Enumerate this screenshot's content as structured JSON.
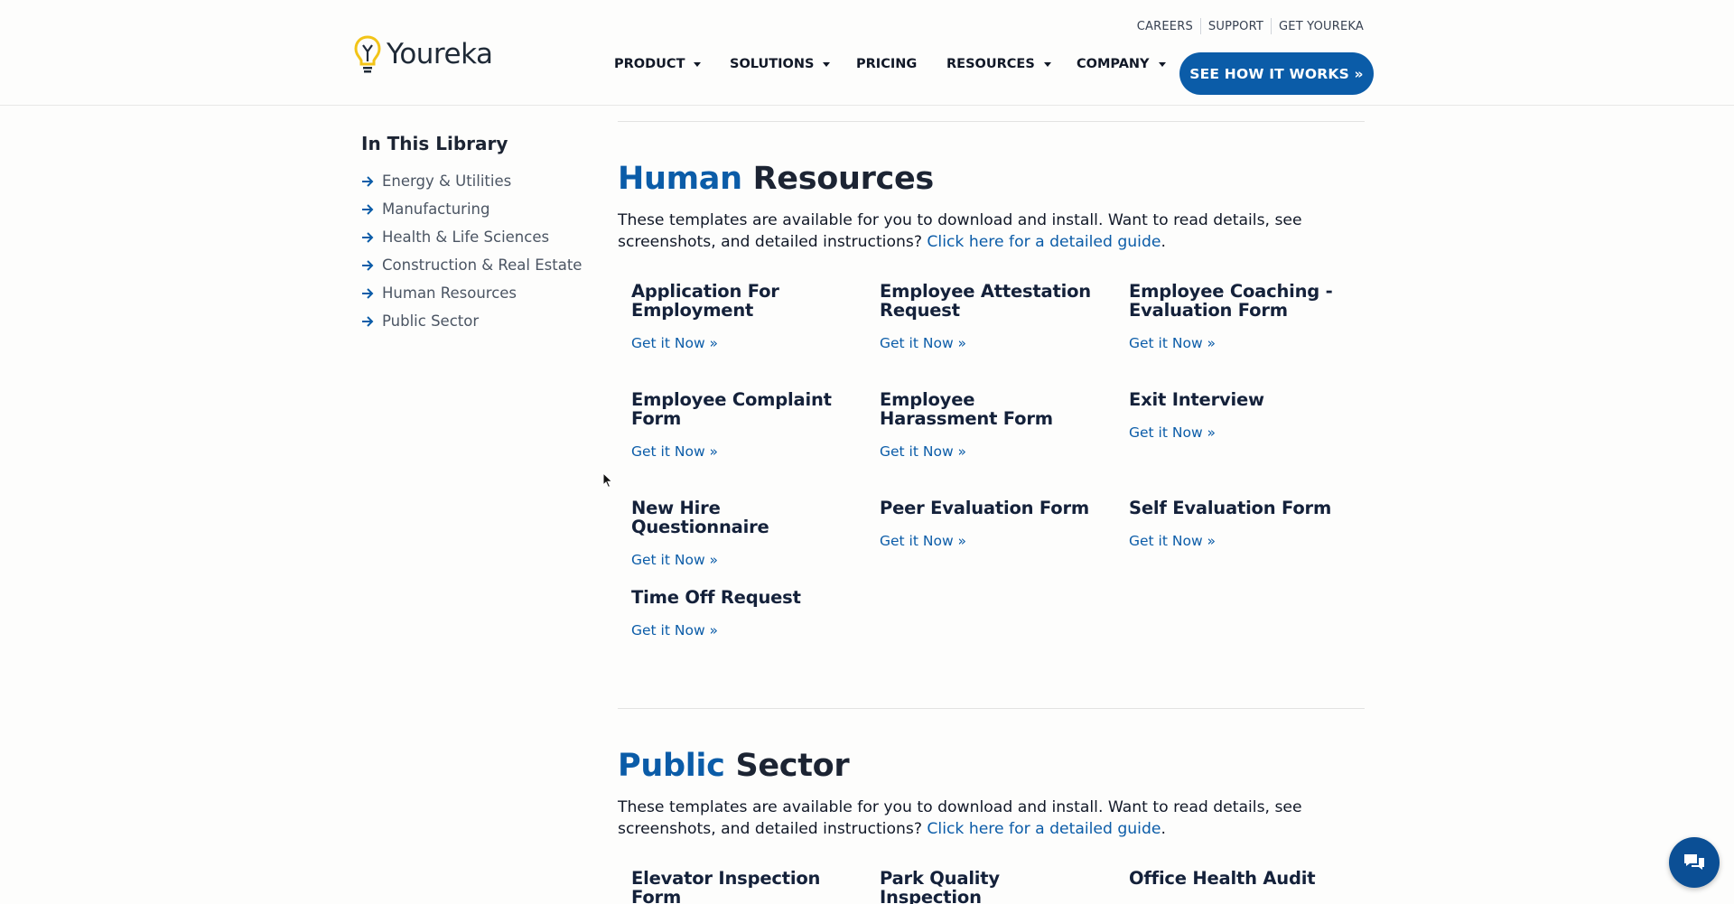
{
  "brand": {
    "name": "Youreka"
  },
  "top_links": [
    "CAREERS",
    "SUPPORT",
    "GET YOUREKA"
  ],
  "nav": [
    {
      "label": "PRODUCT",
      "dropdown": true
    },
    {
      "label": "SOLUTIONS",
      "dropdown": true
    },
    {
      "label": "PRICING",
      "dropdown": false
    },
    {
      "label": "RESOURCES",
      "dropdown": true
    },
    {
      "label": "COMPANY",
      "dropdown": true
    }
  ],
  "cta": {
    "label": "SEE HOW IT WORKS »"
  },
  "sidebar": {
    "title": "In This Library",
    "items": [
      {
        "label": "Energy & Utilities"
      },
      {
        "label": "Manufacturing"
      },
      {
        "label": "Health & Life Sciences"
      },
      {
        "label": "Construction & Real Estate"
      },
      {
        "label": "Human Resources"
      },
      {
        "label": "Public Sector"
      }
    ]
  },
  "sections": [
    {
      "title_accent": "Human",
      "title_rest": " Resources",
      "intro_text": "These templates are available for you to download and install. Want to read details, see screenshots, and detailed instructions? ",
      "intro_link": "Click here for a detailed guide",
      "intro_end": ".",
      "cards": [
        {
          "title": "Application For Employment",
          "link": "Get it Now »"
        },
        {
          "title": "Employee Attestation Request",
          "link": "Get it Now »"
        },
        {
          "title": "Employee Coaching - Evaluation Form",
          "link": "Get it Now »"
        },
        {
          "title": "Employee Complaint Form",
          "link": "Get it Now »"
        },
        {
          "title": "Employee Harassment Form",
          "link": "Get it Now »"
        },
        {
          "title": "Exit Interview",
          "link": "Get it Now »"
        },
        {
          "title": "New Hire Questionnaire",
          "link": "Get it Now »"
        },
        {
          "title": "Peer Evaluation Form",
          "link": "Get it Now »"
        },
        {
          "title": "Self Evaluation Form",
          "link": "Get it Now »"
        },
        {
          "title": "Time Off Request",
          "link": "Get it Now »"
        }
      ]
    },
    {
      "title_accent": "Public",
      "title_rest": " Sector",
      "intro_text": "These templates are available for you to download and install. Want to read details, see screenshots, and detailed instructions? ",
      "intro_link": "Click here for a detailed guide",
      "intro_end": ".",
      "cards": [
        {
          "title": "Elevator Inspection Form"
        },
        {
          "title": "Park Quality Inspection"
        },
        {
          "title": "Office Health Audit"
        }
      ]
    }
  ],
  "colors": {
    "accent": "#0b5ca8",
    "heading": "#1c2433",
    "chat": "#0b4f95"
  },
  "icons": {
    "sidebar_arrow": "arrow-right-icon",
    "chat": "chat-icon",
    "logo": "lightbulb-icon"
  }
}
